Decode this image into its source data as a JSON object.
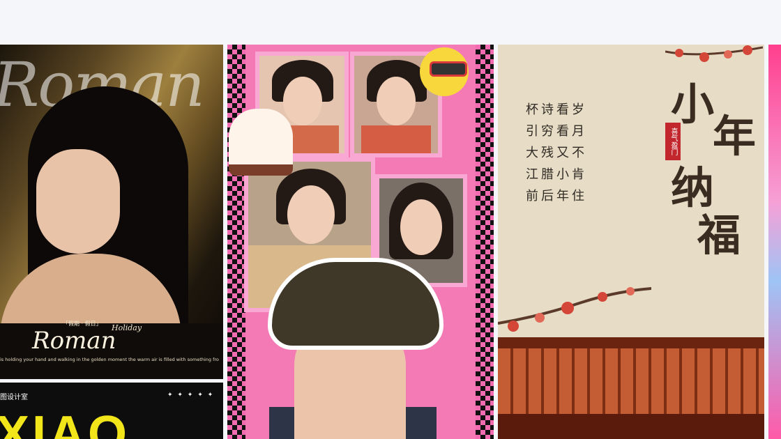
{
  "cards": [
    {
      "id": "roman",
      "big_word": "Roman",
      "small_tag": "「假期 · 假日」",
      "holiday": "Holiday",
      "title": "Roman",
      "description": "is holding your hand and walking in the golden moment the warm air is filled with something fro"
    },
    {
      "id": "xiao",
      "label": "图设计室",
      "stars": "✦ ✦ ✦ ✦ ✦",
      "big_text": "XIAO"
    },
    {
      "id": "pink-collage"
    },
    {
      "id": "chinese-new-year",
      "poem_lines": [
        "杯诗看岁",
        "引穷看月",
        "大残又不",
        "江腊小肯",
        "前后年住"
      ],
      "title_chars": [
        "小",
        "年",
        "纳",
        "福"
      ],
      "stamp": "喜气盈门"
    },
    {
      "id": "partial-pink"
    }
  ],
  "colors": {
    "page_bg": "#f4f6f9",
    "xiao_yellow": "#f2e51a",
    "collage_pink": "#f47ab6",
    "stamp_red": "#c1272d"
  }
}
